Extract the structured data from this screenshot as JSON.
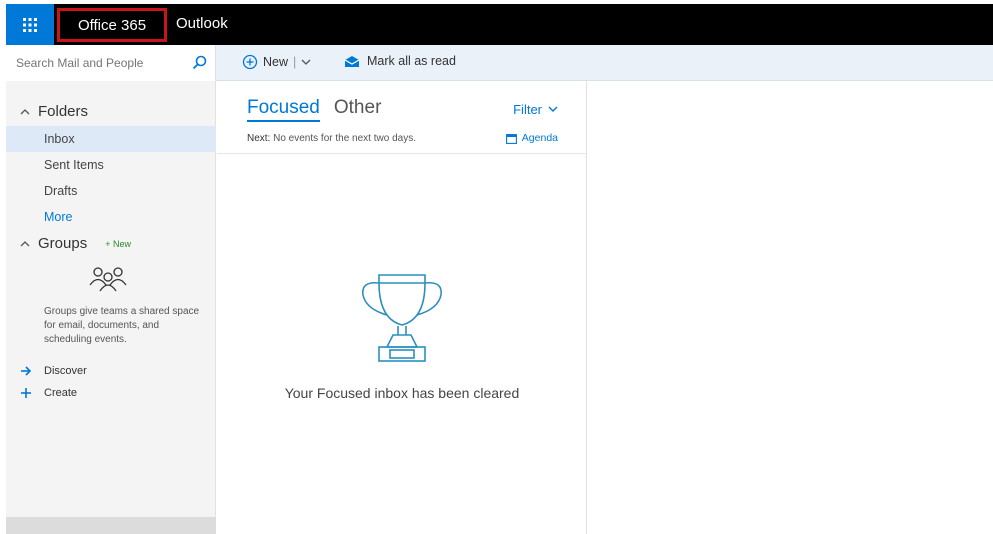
{
  "header": {
    "brand": "Office 365",
    "app_name": "Outlook",
    "brand_highlight_color": "#c9141e",
    "accent_color": "#0078d7"
  },
  "search": {
    "placeholder": "Search Mail and People"
  },
  "toolbar": {
    "new_label": "New",
    "mark_all_read_label": "Mark all as read"
  },
  "sidebar": {
    "folders_heading": "Folders",
    "items": [
      {
        "label": "Inbox",
        "selected": true
      },
      {
        "label": "Sent Items"
      },
      {
        "label": "Drafts"
      },
      {
        "label": "More"
      }
    ],
    "groups_heading": "Groups",
    "groups_badge": "New",
    "groups_description": "Groups give teams a shared space for email, documents, and scheduling events.",
    "discover_label": "Discover",
    "create_label": "Create"
  },
  "message_list": {
    "tabs": [
      "Focused",
      "Other"
    ],
    "active_tab": "Focused",
    "filter_label": "Filter",
    "next_prefix": "Next:",
    "next_text": " No events for the next two days.",
    "agenda_label": "Agenda",
    "empty_message": "Your Focused inbox has been cleared"
  },
  "icons": [
    "waffle-icon",
    "search-icon",
    "plus-circle-icon",
    "envelope-open-icon",
    "chevron-up-icon",
    "people-icon",
    "arrow-right-icon",
    "plus-icon",
    "calendar-icon",
    "trophy-icon"
  ]
}
